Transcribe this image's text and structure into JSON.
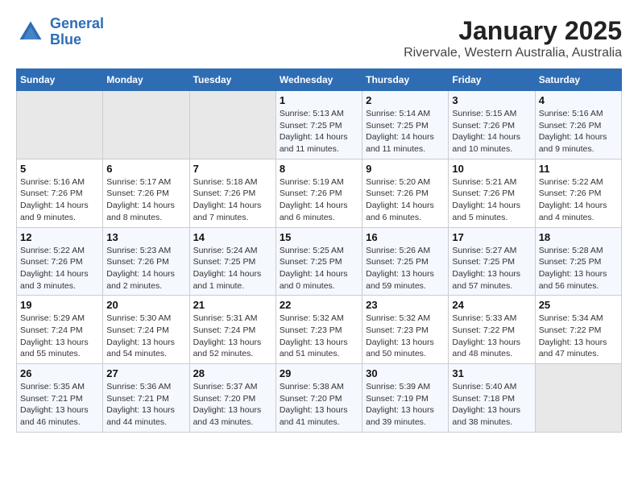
{
  "header": {
    "logo_line1": "General",
    "logo_line2": "Blue",
    "title": "January 2025",
    "subtitle": "Rivervale, Western Australia, Australia"
  },
  "weekdays": [
    "Sunday",
    "Monday",
    "Tuesday",
    "Wednesday",
    "Thursday",
    "Friday",
    "Saturday"
  ],
  "weeks": [
    [
      {
        "num": "",
        "info": ""
      },
      {
        "num": "",
        "info": ""
      },
      {
        "num": "",
        "info": ""
      },
      {
        "num": "1",
        "info": "Sunrise: 5:13 AM\nSunset: 7:25 PM\nDaylight: 14 hours and 11 minutes."
      },
      {
        "num": "2",
        "info": "Sunrise: 5:14 AM\nSunset: 7:25 PM\nDaylight: 14 hours and 11 minutes."
      },
      {
        "num": "3",
        "info": "Sunrise: 5:15 AM\nSunset: 7:26 PM\nDaylight: 14 hours and 10 minutes."
      },
      {
        "num": "4",
        "info": "Sunrise: 5:16 AM\nSunset: 7:26 PM\nDaylight: 14 hours and 9 minutes."
      }
    ],
    [
      {
        "num": "5",
        "info": "Sunrise: 5:16 AM\nSunset: 7:26 PM\nDaylight: 14 hours and 9 minutes."
      },
      {
        "num": "6",
        "info": "Sunrise: 5:17 AM\nSunset: 7:26 PM\nDaylight: 14 hours and 8 minutes."
      },
      {
        "num": "7",
        "info": "Sunrise: 5:18 AM\nSunset: 7:26 PM\nDaylight: 14 hours and 7 minutes."
      },
      {
        "num": "8",
        "info": "Sunrise: 5:19 AM\nSunset: 7:26 PM\nDaylight: 14 hours and 6 minutes."
      },
      {
        "num": "9",
        "info": "Sunrise: 5:20 AM\nSunset: 7:26 PM\nDaylight: 14 hours and 6 minutes."
      },
      {
        "num": "10",
        "info": "Sunrise: 5:21 AM\nSunset: 7:26 PM\nDaylight: 14 hours and 5 minutes."
      },
      {
        "num": "11",
        "info": "Sunrise: 5:22 AM\nSunset: 7:26 PM\nDaylight: 14 hours and 4 minutes."
      }
    ],
    [
      {
        "num": "12",
        "info": "Sunrise: 5:22 AM\nSunset: 7:26 PM\nDaylight: 14 hours and 3 minutes."
      },
      {
        "num": "13",
        "info": "Sunrise: 5:23 AM\nSunset: 7:26 PM\nDaylight: 14 hours and 2 minutes."
      },
      {
        "num": "14",
        "info": "Sunrise: 5:24 AM\nSunset: 7:25 PM\nDaylight: 14 hours and 1 minute."
      },
      {
        "num": "15",
        "info": "Sunrise: 5:25 AM\nSunset: 7:25 PM\nDaylight: 14 hours and 0 minutes."
      },
      {
        "num": "16",
        "info": "Sunrise: 5:26 AM\nSunset: 7:25 PM\nDaylight: 13 hours and 59 minutes."
      },
      {
        "num": "17",
        "info": "Sunrise: 5:27 AM\nSunset: 7:25 PM\nDaylight: 13 hours and 57 minutes."
      },
      {
        "num": "18",
        "info": "Sunrise: 5:28 AM\nSunset: 7:25 PM\nDaylight: 13 hours and 56 minutes."
      }
    ],
    [
      {
        "num": "19",
        "info": "Sunrise: 5:29 AM\nSunset: 7:24 PM\nDaylight: 13 hours and 55 minutes."
      },
      {
        "num": "20",
        "info": "Sunrise: 5:30 AM\nSunset: 7:24 PM\nDaylight: 13 hours and 54 minutes."
      },
      {
        "num": "21",
        "info": "Sunrise: 5:31 AM\nSunset: 7:24 PM\nDaylight: 13 hours and 52 minutes."
      },
      {
        "num": "22",
        "info": "Sunrise: 5:32 AM\nSunset: 7:23 PM\nDaylight: 13 hours and 51 minutes."
      },
      {
        "num": "23",
        "info": "Sunrise: 5:32 AM\nSunset: 7:23 PM\nDaylight: 13 hours and 50 minutes."
      },
      {
        "num": "24",
        "info": "Sunrise: 5:33 AM\nSunset: 7:22 PM\nDaylight: 13 hours and 48 minutes."
      },
      {
        "num": "25",
        "info": "Sunrise: 5:34 AM\nSunset: 7:22 PM\nDaylight: 13 hours and 47 minutes."
      }
    ],
    [
      {
        "num": "26",
        "info": "Sunrise: 5:35 AM\nSunset: 7:21 PM\nDaylight: 13 hours and 46 minutes."
      },
      {
        "num": "27",
        "info": "Sunrise: 5:36 AM\nSunset: 7:21 PM\nDaylight: 13 hours and 44 minutes."
      },
      {
        "num": "28",
        "info": "Sunrise: 5:37 AM\nSunset: 7:20 PM\nDaylight: 13 hours and 43 minutes."
      },
      {
        "num": "29",
        "info": "Sunrise: 5:38 AM\nSunset: 7:20 PM\nDaylight: 13 hours and 41 minutes."
      },
      {
        "num": "30",
        "info": "Sunrise: 5:39 AM\nSunset: 7:19 PM\nDaylight: 13 hours and 39 minutes."
      },
      {
        "num": "31",
        "info": "Sunrise: 5:40 AM\nSunset: 7:18 PM\nDaylight: 13 hours and 38 minutes."
      },
      {
        "num": "",
        "info": ""
      }
    ]
  ]
}
